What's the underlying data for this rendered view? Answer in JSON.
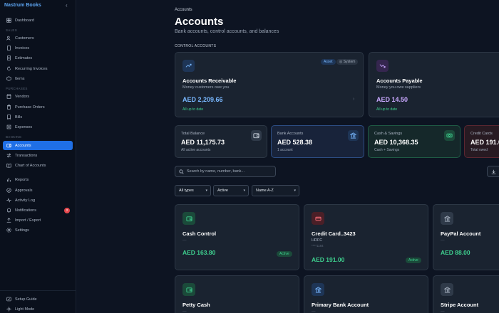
{
  "sidebar": {
    "brand": "Nastrum Books",
    "collapse_icon": "chevron-left-icon",
    "sections": {
      "sales": "SALES",
      "purchases": "PURCHASES",
      "banking": "BANKING"
    },
    "items": {
      "dashboard": "Dashboard",
      "customers": "Customers",
      "invoices": "Invoices",
      "estimates": "Estimates",
      "recurring": "Recurring Invoices",
      "items": "Items",
      "vendors": "Vendors",
      "purchase_orders": "Purchase Orders",
      "bills": "Bills",
      "expenses": "Expenses",
      "accounts": "Accounts",
      "transactions": "Transactions",
      "chart_of_accounts": "Chart of Accounts",
      "reports": "Reports",
      "approvals": "Approvals",
      "activity_log": "Activity Log",
      "notifications": "Notifications",
      "import_export": "Import / Export",
      "settings": "Settings",
      "setup_guide": "Setup Guide",
      "light_mode": "Light Mode"
    },
    "notifications_count": "2"
  },
  "page": {
    "breadcrumb": "Accounts",
    "title": "Accounts",
    "subtitle": "Bank accounts, control accounts, and balances",
    "control_heading": "CONTROL ACCOUNTS"
  },
  "control_accounts": [
    {
      "name": "Accounts Receivable",
      "desc": "Money customers owe you",
      "amount": "AED 2,209.66",
      "status": "All up to date",
      "tag1": "Asset",
      "tag2": "System"
    },
    {
      "name": "Accounts Payable",
      "desc": "Money you owe suppliers",
      "amount": "AED 14.50",
      "status": "All up to date"
    }
  ],
  "summary": [
    {
      "label": "Total Balance",
      "value": "AED 11,175.73",
      "sub": "All active accounts"
    },
    {
      "label": "Bank Accounts",
      "value": "AED 528.38",
      "sub": "1 account"
    },
    {
      "label": "Cash & Savings",
      "value": "AED 10,368.35",
      "sub": "Cash + Savings"
    },
    {
      "label": "Credit Cards",
      "value": "AED 191.0",
      "sub": "Total owed"
    }
  ],
  "filters": {
    "search_placeholder": "Search by name, number, bank...",
    "type": "All types",
    "status": "Active",
    "sort": "Name A-Z"
  },
  "accounts": [
    {
      "name": "Cash Control",
      "sub": "—",
      "amount": "AED 163.80",
      "status": "Active"
    },
    {
      "name": "Credit Card..3423",
      "sub": "HDFC",
      "sub2": "****1184",
      "amount": "AED 191.00",
      "status": "Active"
    },
    {
      "name": "PayPal Account",
      "sub": "—",
      "amount": "AED 88.00"
    },
    {
      "name": "Petty Cash",
      "sub": "—"
    },
    {
      "name": "Primary Bank Account",
      "sub": "—"
    },
    {
      "name": "Stripe Account",
      "sub": "—"
    }
  ],
  "colors": {
    "accent": "#1f6fe6",
    "positive": "#3ecf8e",
    "receivable_amount": "#79b8ff",
    "payable_amount": "#c9a8ff"
  }
}
